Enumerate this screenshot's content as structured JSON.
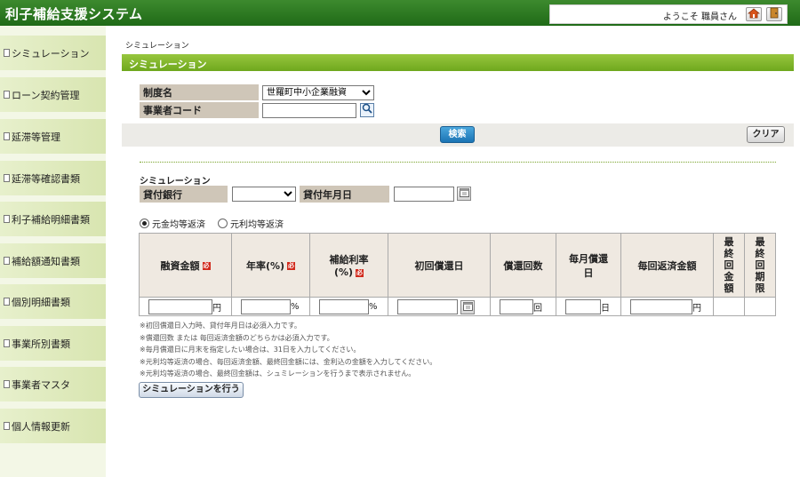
{
  "header": {
    "app_title": "利子補給支援システム",
    "welcome": "ようこそ 職員さん",
    "home_icon": "home-icon",
    "logout_icon": "logout-door-icon"
  },
  "sidebar": {
    "items": [
      {
        "label": "シミュレーション"
      },
      {
        "label": "ローン契約管理"
      },
      {
        "label": "延滞等管理"
      },
      {
        "label": "延滞等確認書類"
      },
      {
        "label": "利子補給明細書類"
      },
      {
        "label": "補給額通知書類"
      },
      {
        "label": "個別明細書類"
      },
      {
        "label": "事業所別書類"
      },
      {
        "label": "事業者マスタ"
      },
      {
        "label": "個人情報更新"
      }
    ]
  },
  "breadcrumb": "シミュレーション",
  "section_title": "シミュレーション",
  "search_form": {
    "seido_label": "制度名",
    "seido_value": "世羅町中小企業融資",
    "code_label": "事業者コード",
    "code_value": "",
    "search_button": "検索",
    "clear_button": "クリア"
  },
  "simulation": {
    "label": "シミュレーション",
    "bank_label": "貸付銀行",
    "bank_value": "",
    "date_label": "貸付年月日",
    "date_value": "",
    "radio_equal_principal": "元金均等返済",
    "radio_equal_payment": "元利均等返済",
    "selected_radio": "元金均等返済",
    "required_mark": "必",
    "columns": {
      "amount": "融資金額",
      "rate": "年率(%)",
      "subsidy_rate_1": "補給利率",
      "subsidy_rate_2": "(%)",
      "first_date": "初回償還日",
      "count": "償還回数",
      "monthly_day_1": "毎月償還",
      "monthly_day_2": "日",
      "each_amount": "毎回返済金額",
      "last_amount": "最終回金額",
      "last_period": "最終回期限"
    },
    "units": {
      "yen": "円",
      "percent": "%",
      "times": "回",
      "day": "日"
    },
    "notes": [
      "※初回償還日入力時、貸付年月日は必須入力です。",
      "※償還回数 または 毎回返済金額のどちらかは必須入力です。",
      "※毎月償還日に月末を指定したい場合は、31日を入力してください。",
      "※元利均等返済の場合、毎回返済金額、最終回金額には、金利込の金額を入力してください。",
      "※元利均等返済の場合、最終回金額は、シュミレーションを行うまで表示されません。"
    ],
    "run_button": "シミュレーションを行う"
  },
  "colors": {
    "header_green": "#1f6a17",
    "section_green": "#7cb228",
    "sidebar_bg": "#dce8b8",
    "label_bg": "#cfc6b8",
    "search_blue": "#1b74b4",
    "required_red": "#d12a1c"
  }
}
